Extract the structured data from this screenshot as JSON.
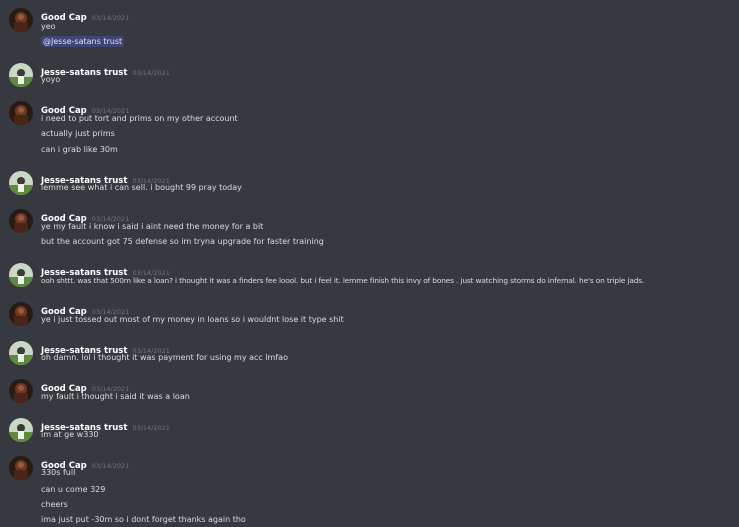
{
  "messages": [
    {
      "author": "Good Cap",
      "time": "03/14/2021",
      "avatar": "good-cap",
      "lines": [
        "yeo",
        "@Jesse-satans trust"
      ]
    },
    {
      "author": "Jesse-satans trust",
      "time": "03/14/2021",
      "avatar": "jesse",
      "lines": [
        "yoyo"
      ]
    },
    {
      "author": "Good Cap",
      "time": "03/14/2021",
      "avatar": "good-cap",
      "lines": [
        "i need to put tort and prims on my other account",
        "actually just prims",
        "can i grab like 30m"
      ]
    },
    {
      "author": "Jesse-satans trust",
      "time": "03/14/2021",
      "avatar": "jesse",
      "lines": [
        "lemme see what i can sell. i bought 99 pray today"
      ]
    },
    {
      "author": "Good Cap",
      "time": "03/14/2021",
      "avatar": "good-cap",
      "lines": [
        "ye my fault i know i said i aint need the money for a bit",
        "but the account got 75 defense so im tryna upgrade for faster training"
      ]
    },
    {
      "author": "Jesse-satans trust",
      "time": "03/14/2021",
      "avatar": "jesse",
      "lines": [
        "ooh shttt. was that 500m like a loan? i thought it was a finders fee loool. but i feel it. lemme finish this invy of bones . just watching storms do infernal. he's on triple jads."
      ]
    },
    {
      "author": "Good Cap",
      "time": "03/14/2021",
      "avatar": "good-cap",
      "lines": [
        "ye i just tossed out most of my money in loans so i wouldnt lose it type shit"
      ]
    },
    {
      "author": "Jesse-satans trust",
      "time": "03/14/2021",
      "avatar": "jesse",
      "lines": [
        "oh damn. lol i thought it was payment for using my acc lmfao"
      ]
    },
    {
      "author": "Good Cap",
      "time": "03/14/2021",
      "avatar": "good-cap",
      "lines": [
        "my fault i thought i said it was a loan"
      ]
    },
    {
      "author": "Jesse-satans trust",
      "time": "03/14/2021",
      "avatar": "jesse",
      "lines": [
        "im at ge w330"
      ]
    },
    {
      "author": "Good Cap",
      "time": "03/14/2021",
      "avatar": "good-cap",
      "lines": [
        "330s full",
        "can u come 329",
        "cheers",
        "ima just put -30m so i dont forget thanks again tho"
      ]
    }
  ]
}
